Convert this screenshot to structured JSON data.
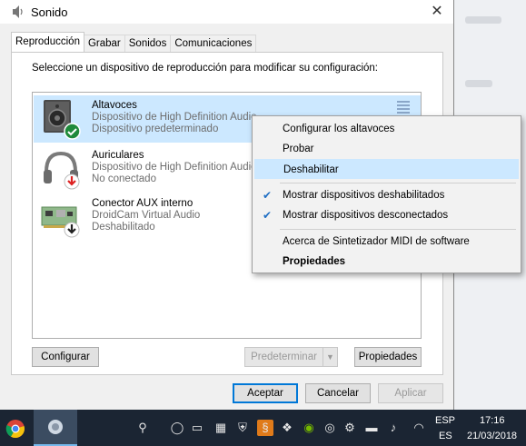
{
  "window": {
    "title": "Sonido",
    "close_glyph": "✕"
  },
  "tabs": [
    {
      "label": "Reproducción",
      "active": true
    },
    {
      "label": "Grabar",
      "active": false
    },
    {
      "label": "Sonidos",
      "active": false
    },
    {
      "label": "Comunicaciones",
      "active": false
    }
  ],
  "instruction": "Seleccione un dispositivo de reproducción para modificar su configuración:",
  "devices": [
    {
      "name": "Altavoces",
      "description": "Dispositivo de High Definition Audio",
      "status": "Dispositivo predeterminado",
      "icon": "speaker-icon",
      "badge": "default-check-badge",
      "selected": true
    },
    {
      "name": "Auriculares",
      "description": "Dispositivo de High Definition Audio",
      "status": "No conectado",
      "icon": "headphones-icon",
      "badge": "disconnected-arrow-badge",
      "selected": false
    },
    {
      "name": "Conector AUX interno",
      "description": "DroidCam Virtual Audio",
      "status": "Deshabilitado",
      "icon": "circuit-board-icon",
      "badge": "disabled-arrow-badge",
      "selected": false
    }
  ],
  "buttons": {
    "configure": "Configurar",
    "set_default": "Predeterminar",
    "properties": "Propiedades",
    "accept": "Aceptar",
    "cancel": "Cancelar",
    "apply": "Aplicar"
  },
  "context_menu": {
    "items": [
      {
        "label": "Configurar los altavoces",
        "checked": false,
        "bold": false,
        "hover": false
      },
      {
        "label": "Probar",
        "checked": false,
        "bold": false,
        "hover": false
      },
      {
        "label": "Deshabilitar",
        "checked": false,
        "bold": false,
        "hover": true
      },
      {
        "label": "Mostrar dispositivos deshabilitados",
        "checked": true,
        "bold": false,
        "hover": false
      },
      {
        "label": "Mostrar dispositivos desconectados",
        "checked": true,
        "bold": false,
        "hover": false
      },
      {
        "label": "Acerca de Sintetizador MIDI de software",
        "checked": false,
        "bold": false,
        "hover": false
      },
      {
        "label": "Propiedades",
        "checked": false,
        "bold": true,
        "hover": false
      }
    ]
  },
  "taskbar": {
    "language_line1": "ESP",
    "language_line2": "ES",
    "time": "17:16",
    "date": "21/03/2018"
  },
  "colors": {
    "accent": "#0078d7",
    "selection": "#cce8ff",
    "taskbar": "#1b2533"
  }
}
